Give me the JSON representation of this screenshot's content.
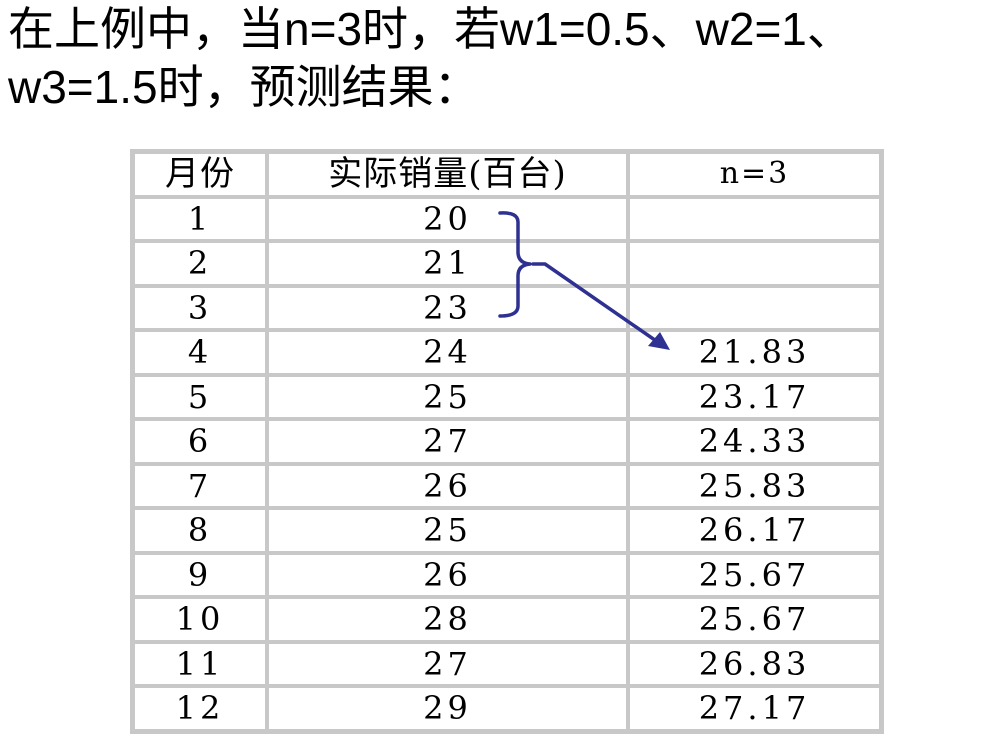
{
  "heading": {
    "line1": "在上例中，当n=3时，若w1=0.5、w2=1、",
    "line2": "w3=1.5时，预测结果："
  },
  "table": {
    "headers": [
      "月份",
      "实际销量(百台)",
      "n=3"
    ],
    "rows": [
      {
        "month": "1",
        "sales": "20",
        "forecast": ""
      },
      {
        "month": "2",
        "sales": "21",
        "forecast": ""
      },
      {
        "month": "3",
        "sales": "23",
        "forecast": ""
      },
      {
        "month": "4",
        "sales": "24",
        "forecast": "21.83"
      },
      {
        "month": "5",
        "sales": "25",
        "forecast": "23.17"
      },
      {
        "month": "6",
        "sales": "27",
        "forecast": "24.33"
      },
      {
        "month": "7",
        "sales": "26",
        "forecast": "25.83"
      },
      {
        "month": "8",
        "sales": "25",
        "forecast": "26.17"
      },
      {
        "month": "9",
        "sales": "26",
        "forecast": "25.67"
      },
      {
        "month": "10",
        "sales": "28",
        "forecast": "25.67"
      },
      {
        "month": "11",
        "sales": "27",
        "forecast": "26.83"
      },
      {
        "month": "12",
        "sales": "29",
        "forecast": "27.17"
      }
    ]
  },
  "annotation": {
    "color": "#2e3192",
    "icon": "bracket-arrow-icon"
  }
}
